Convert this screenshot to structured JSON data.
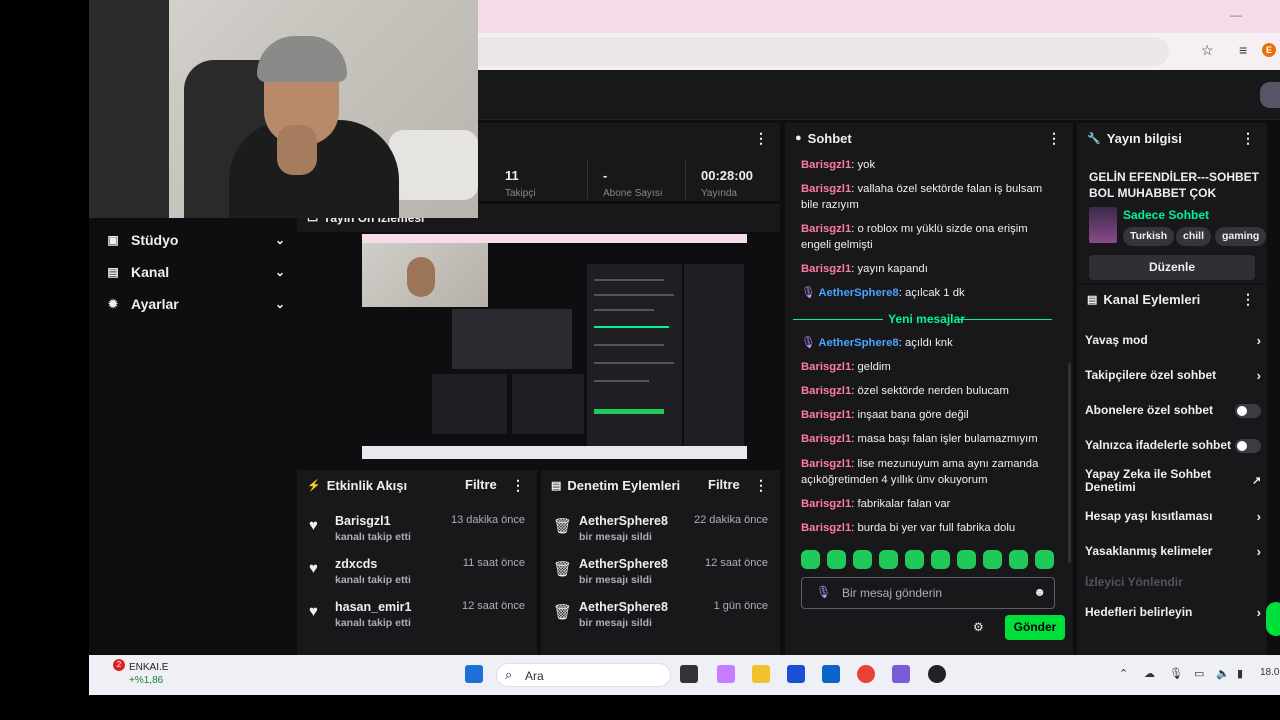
{
  "colors": {
    "accent_green": "#00f593",
    "send_green": "#00e03b",
    "chat_user": "#ff7aa8",
    "chat_user_blue": "#4aa3ff",
    "panel_bg": "#18181b"
  },
  "nav": {
    "items": [
      {
        "label": "Stüdyo",
        "icon": "studio-icon"
      },
      {
        "label": "Kanal",
        "icon": "channel-icon"
      },
      {
        "label": "Ayarlar",
        "icon": "gear-icon"
      }
    ]
  },
  "preview": {
    "title": "Yayın Ön İzlemesi"
  },
  "stats": {
    "followers": "11",
    "subs": "-",
    "duration": "00:28:00",
    "followers_label": "Takipçi",
    "subs_label": "Abone Sayısı",
    "duration_label": "Yayında"
  },
  "activity": {
    "title": "Etkinlik Akışı",
    "filter": "Filtre",
    "items": [
      {
        "name": "Barisgzl1",
        "sub": "kanalı takip etti",
        "time": "13 dakika önce"
      },
      {
        "name": "zdxcds",
        "sub": "kanalı takip etti",
        "time": "11 saat önce"
      },
      {
        "name": "hasan_emir1",
        "sub": "kanalı takip etti",
        "time": "12 saat önce"
      }
    ]
  },
  "moderation": {
    "title": "Denetim Eylemleri",
    "filter": "Filtre",
    "items": [
      {
        "name": "AetherSphere8",
        "sub": "bir mesajı sildi",
        "time": "22 dakika önce"
      },
      {
        "name": "AetherSphere8",
        "sub": "bir mesajı sildi",
        "time": "12 saat önce"
      },
      {
        "name": "AetherSphere8",
        "sub": "bir mesajı sildi",
        "time": "1 gün önce"
      }
    ]
  },
  "chat": {
    "title": "Sohbet",
    "new_messages": "Yeni mesajlar",
    "placeholder": "Bir mesaj gönderin",
    "send": "Gönder",
    "messages": [
      {
        "user": "Barisgzl1",
        "text": "yok"
      },
      {
        "user": "Barisgzl1",
        "text": "vallaha özel sektörde falan iş bulsam bile razıyım"
      },
      {
        "user": "Barisgzl1",
        "text": "o roblox mı yüklü sizde ona erişim engeli gelmişti"
      },
      {
        "user": "Barisgzl1",
        "text": "yayın kapandı"
      },
      {
        "user": "AetherSphere8",
        "text": "açılcak 1 dk"
      },
      {
        "user": "AetherSphere8",
        "text": "açıldı knk"
      },
      {
        "user": "Barisgzl1",
        "text": "geldim"
      },
      {
        "user": "Barisgzl1",
        "text": "özel sektörde nerden bulucam"
      },
      {
        "user": "Barisgzl1",
        "text": "inşaat bana göre değil"
      },
      {
        "user": "Barisgzl1",
        "text": "masa başı falan işler bulamazmıyım"
      },
      {
        "user": "Barisgzl1",
        "text": "lise mezunuyum ama aynı zamanda açıköğretimden 4 yıllık ünv okuyorum"
      },
      {
        "user": "Barisgzl1",
        "text": "fabrikalar falan var"
      },
      {
        "user": "Barisgzl1",
        "text": "burda bi yer var full fabrika dolu"
      }
    ]
  },
  "stream_info": {
    "title": "Yayın bilgisi",
    "stream_title": "GELİN EFENDİLER---SOHBET BOL MUHABBET ÇOK",
    "category": "Sadece Sohbet",
    "tags": [
      "Turkish",
      "chill",
      "gaming"
    ],
    "edit": "Düzenle"
  },
  "channel_actions": {
    "title": "Kanal Eylemleri",
    "items": [
      {
        "label": "Yavaş mod",
        "control": "chevron"
      },
      {
        "label": "Takipçilere özel sohbet",
        "control": "chevron"
      },
      {
        "label": "Abonelere özel sohbet",
        "control": "toggle"
      },
      {
        "label": "Yalnızca ifadelerle sohbet",
        "control": "toggle"
      },
      {
        "label": "Yapay Zeka ile Sohbet Denetimi",
        "control": "external"
      },
      {
        "label": "Hesap yaşı kısıtlaması",
        "control": "chevron"
      },
      {
        "label": "Yasaklanmış kelimeler",
        "control": "chevron"
      },
      {
        "label": "İzleyici Yönlendir",
        "control": "none"
      },
      {
        "label": "Hedefleri belirleyin",
        "control": "chevron"
      }
    ]
  },
  "taskbar": {
    "stock_name": "ENKAI.E",
    "stock_change": "+%1,86",
    "badge": "2",
    "search": "Ara",
    "clock": "18.0"
  }
}
